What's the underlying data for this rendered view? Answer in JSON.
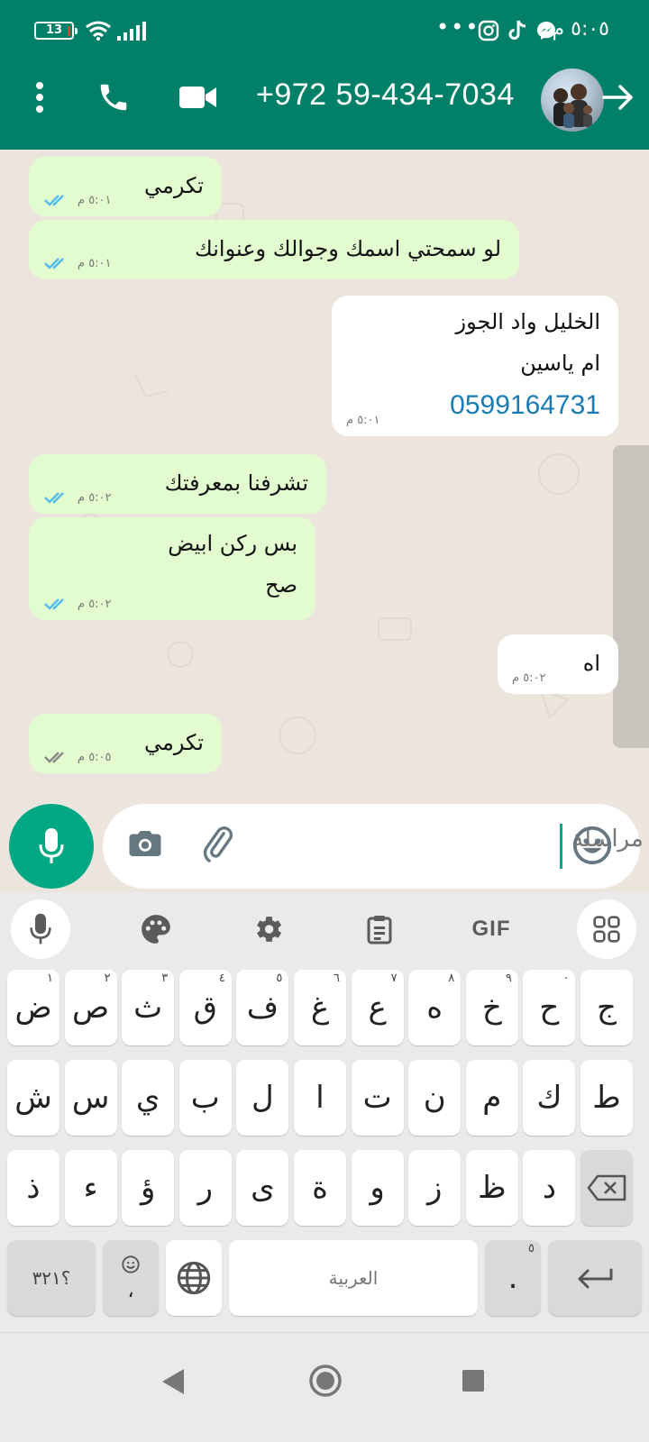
{
  "status_bar": {
    "battery": "13",
    "time": "٥:٠٥ م",
    "more": "•••",
    "icons": [
      "messenger-icon",
      "tiktok-icon",
      "instagram-icon",
      "wifi-icon",
      "signal-icon"
    ]
  },
  "header": {
    "title": "+972 59-434-7034",
    "icons": [
      "back-arrow-icon",
      "avatar",
      "video-call-icon",
      "voice-call-icon",
      "more-vert-icon"
    ]
  },
  "messages": [
    {
      "dir": "out",
      "text": "تكرمي",
      "time": "٥:٠١ م",
      "status": "read"
    },
    {
      "dir": "out",
      "text": "لو سمحتي اسمك وجوالك وعنوانك",
      "time": "٥:٠١ م",
      "status": "read"
    },
    {
      "dir": "in",
      "lines": [
        "الخليل واد الجوز",
        "ام ياسين"
      ],
      "phone": "0599164731",
      "time": "٥:٠١ م"
    },
    {
      "dir": "out",
      "text": "تشرفنا بمعرفتك",
      "time": "٥:٠٢ م",
      "status": "read"
    },
    {
      "dir": "out",
      "lines": [
        "بس ركن ابيض",
        "صح"
      ],
      "time": "٥:٠٢ م",
      "status": "read"
    },
    {
      "dir": "in",
      "text": "اه",
      "time": "٥:٠٢ م"
    },
    {
      "dir": "out",
      "text": "تكرمي",
      "time": "٥:٠٥ م",
      "status": "delivered"
    }
  ],
  "colors": {
    "header": "#008069",
    "accent": "#00a884",
    "outgoing": "#e2fcd0",
    "read_tick": "#53bdeb",
    "link": "#1a7bb5"
  },
  "composer": {
    "placeholder": "مراسلة"
  },
  "keyboard": {
    "toolbar": [
      "mic-icon",
      "palette-icon",
      "settings-icon",
      "clipboard-icon",
      "GIF",
      "grid-icon"
    ],
    "row1": [
      {
        "k": "ض",
        "h": "١"
      },
      {
        "k": "ص",
        "h": "٢"
      },
      {
        "k": "ث",
        "h": "٣"
      },
      {
        "k": "ق",
        "h": "٤"
      },
      {
        "k": "ف",
        "h": "٥"
      },
      {
        "k": "غ",
        "h": "٦"
      },
      {
        "k": "ع",
        "h": "٧"
      },
      {
        "k": "ه",
        "h": "٨"
      },
      {
        "k": "خ",
        "h": "٩"
      },
      {
        "k": "ح",
        "h": "٠"
      },
      {
        "k": "ج",
        "h": ""
      }
    ],
    "row2": [
      "ش",
      "س",
      "ي",
      "ب",
      "ل",
      "ا",
      "ت",
      "ن",
      "م",
      "ك",
      "ط"
    ],
    "row3": [
      "ذ",
      "ء",
      "ؤ",
      "ر",
      "ى",
      "ة",
      "و",
      "ز",
      "ظ",
      "د"
    ],
    "symbols": "؟٣٢١",
    "comma": "،",
    "space": "العربية",
    "period": ".",
    "period_hint": "٥"
  }
}
